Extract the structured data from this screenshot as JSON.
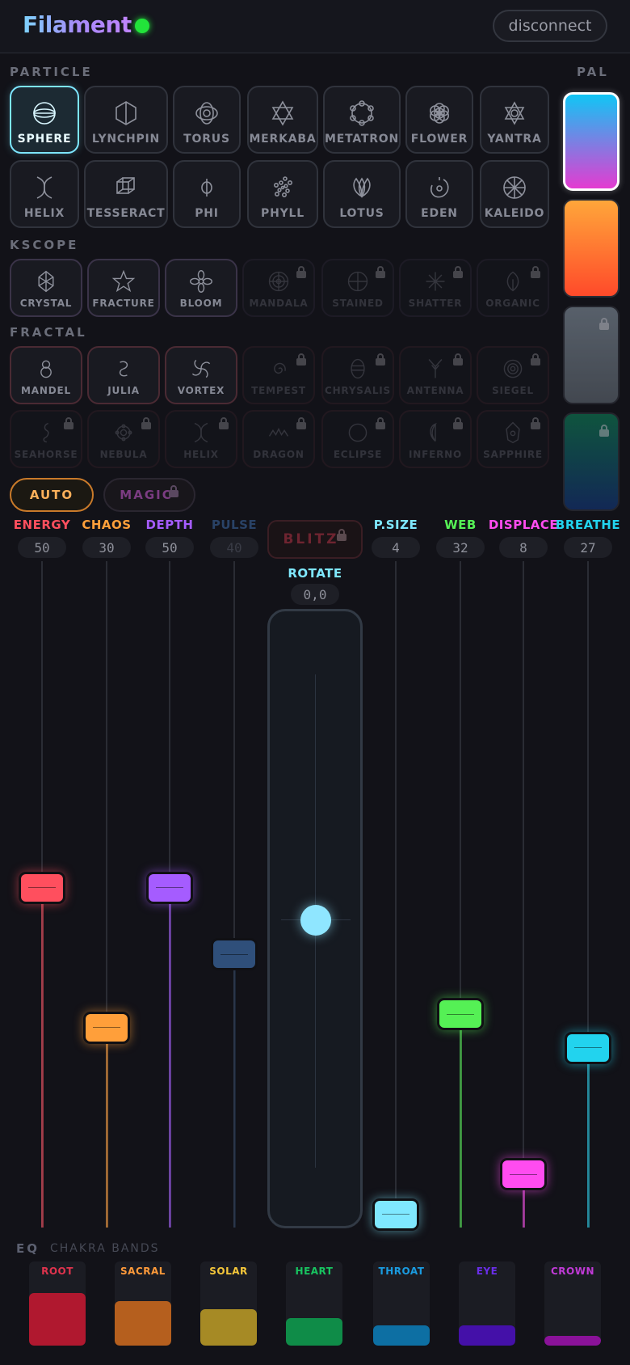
{
  "app": {
    "title": "Filament",
    "disconnect_label": "disconnect"
  },
  "sections": {
    "particle": "PARTICLE",
    "palette": "PAL",
    "kscope": "KSCOPE",
    "fractal": "FRACTAL",
    "eq": "EQ",
    "eq_sub": "CHAKRA BANDS"
  },
  "particle_modes": [
    {
      "label": "SPHERE",
      "icon": "sphere-icon",
      "active": true
    },
    {
      "label": "LYNCHPIN",
      "icon": "hexagon-prism-icon"
    },
    {
      "label": "TORUS",
      "icon": "torus-icon"
    },
    {
      "label": "MERKABA",
      "icon": "star-of-david-icon"
    },
    {
      "label": "METATRON",
      "icon": "metatron-cube-icon"
    },
    {
      "label": "FLOWER",
      "icon": "flower-of-life-icon"
    },
    {
      "label": "YANTRA",
      "icon": "yantra-icon"
    },
    {
      "label": "HELIX",
      "icon": "helix-icon"
    },
    {
      "label": "TESSERACT",
      "icon": "tesseract-icon"
    },
    {
      "label": "PHI",
      "icon": "phi-icon"
    },
    {
      "label": "PHYLL",
      "icon": "phyllotaxis-icon"
    },
    {
      "label": "LOTUS",
      "icon": "lotus-icon"
    },
    {
      "label": "EDEN",
      "icon": "eden-spiral-icon"
    },
    {
      "label": "KALEIDO",
      "icon": "kaleidoscope-wheel-icon"
    }
  ],
  "kscope_modes": [
    {
      "label": "CRYSTAL",
      "icon": "crystal-icon",
      "locked": false
    },
    {
      "label": "FRACTURE",
      "icon": "star-outline-icon",
      "locked": false
    },
    {
      "label": "BLOOM",
      "icon": "bloom-flower-icon",
      "locked": false
    },
    {
      "label": "MANDALA",
      "icon": "mandala-icon",
      "locked": true
    },
    {
      "label": "STAINED",
      "icon": "stained-glass-icon",
      "locked": true
    },
    {
      "label": "SHATTER",
      "icon": "shatter-icon",
      "locked": true
    },
    {
      "label": "ORGANIC",
      "icon": "organic-leaf-icon",
      "locked": true
    }
  ],
  "fractal_modes": [
    {
      "label": "MANDEL",
      "icon": "mandelbrot-icon",
      "locked": false
    },
    {
      "label": "JULIA",
      "icon": "julia-swirl-icon",
      "locked": false
    },
    {
      "label": "VORTEX",
      "icon": "vortex-icon",
      "locked": false
    },
    {
      "label": "TEMPEST",
      "icon": "tempest-spiral-icon",
      "locked": true
    },
    {
      "label": "CHRYSALIS",
      "icon": "chrysalis-icon",
      "locked": true
    },
    {
      "label": "ANTENNA",
      "icon": "antenna-icon",
      "locked": true
    },
    {
      "label": "SIEGEL",
      "icon": "siegel-disk-icon",
      "locked": true
    },
    {
      "label": "SEAHORSE",
      "icon": "seahorse-icon",
      "locked": true
    },
    {
      "label": "NEBULA",
      "icon": "nebula-icon",
      "locked": true
    },
    {
      "label": "HELIX",
      "icon": "helix-icon",
      "locked": true
    },
    {
      "label": "DRAGON",
      "icon": "dragon-curve-icon",
      "locked": true
    },
    {
      "label": "ECLIPSE",
      "icon": "eclipse-icon",
      "locked": true
    },
    {
      "label": "INFERNO",
      "icon": "inferno-icon",
      "locked": true
    },
    {
      "label": "SAPPHIRE",
      "icon": "sapphire-gem-icon",
      "locked": true
    }
  ],
  "palettes": [
    {
      "name": "cyan-magenta",
      "from": "#10c6f5",
      "to": "#e43bd1",
      "selected": true
    },
    {
      "name": "orange-red",
      "from": "#ffa63a",
      "to": "#ff4a2a",
      "selected": false
    },
    {
      "name": "gray",
      "from": "#6f7a86",
      "to": "#535a63",
      "selected": false,
      "locked": true
    },
    {
      "name": "green-blue",
      "from": "#0f6b4b",
      "to": "#12306a",
      "selected": false,
      "locked": true
    }
  ],
  "modes": {
    "auto_label": "AUTO",
    "magic_label": "MAGIC",
    "blitz_label": "BLITZ"
  },
  "faders": [
    {
      "label": "ENERGY",
      "value": "50",
      "color": "#ff4f5e",
      "level": 0.51
    },
    {
      "label": "CHAOS",
      "value": "30",
      "color": "#ff9f3a",
      "level": 0.3
    },
    {
      "label": "DEPTH",
      "value": "50",
      "color": "#a55cff",
      "level": 0.51
    },
    {
      "label": "PULSE",
      "value": "40",
      "color": "#2f4f7a",
      "level": 0.41,
      "disabled": true
    },
    {
      "label": "P.SIZE",
      "value": "4",
      "color": "#7fe8ff",
      "level": 0.02
    },
    {
      "label": "WEB",
      "value": "32",
      "color": "#55f055",
      "level": 0.32
    },
    {
      "label": "DISPLACE",
      "value": "8",
      "color": "#ff4cf0",
      "level": 0.08
    },
    {
      "label": "BREATHE",
      "value": "27",
      "color": "#22d3ee",
      "level": 0.27
    }
  ],
  "rotate": {
    "label": "ROTATE",
    "value": "0,0"
  },
  "eq_bands": [
    {
      "name": "ROOT",
      "color": "#e0334d",
      "bar": "#b0182f",
      "level": 0.74
    },
    {
      "name": "SACRAL",
      "color": "#ff9a3a",
      "bar": "#b55f1e",
      "level": 0.62
    },
    {
      "name": "SOLAR",
      "color": "#f5c73a",
      "bar": "#a68a25",
      "level": 0.5
    },
    {
      "name": "HEART",
      "color": "#18c460",
      "bar": "#0f8c48",
      "level": 0.37
    },
    {
      "name": "THROAT",
      "color": "#1a9be0",
      "bar": "#0d6fa3",
      "level": 0.26
    },
    {
      "name": "EYE",
      "color": "#6a2ee8",
      "bar": "#4410a8",
      "level": 0.25
    },
    {
      "name": "CROWN",
      "color": "#c03ad6",
      "bar": "#8a1299",
      "level": 0.1
    }
  ]
}
